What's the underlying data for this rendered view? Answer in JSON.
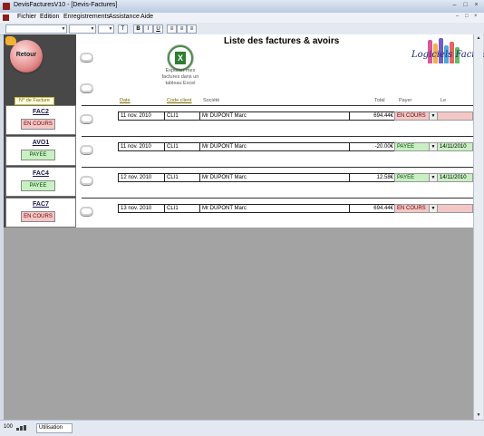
{
  "window": {
    "title": "DevisFacturesV10 - [Devis-Factures]",
    "controls": [
      "–",
      "□",
      "×"
    ]
  },
  "menu": {
    "items": [
      "Fichier",
      "Edition",
      "Enregistrements",
      "Assistance",
      "Aide"
    ],
    "mdi_controls": [
      "–",
      "□",
      "×"
    ]
  },
  "toolbar": {
    "bold": "B",
    "italic": "I",
    "text_tool": "T",
    "underline": "U",
    "align_left": "≡",
    "align_center": "≡",
    "align_right": "≡"
  },
  "sidebar": {
    "back_label": "Retour"
  },
  "header": {
    "title": "Liste des factures & avoirs",
    "export_text": "Exporter mes factures dans un tableau Excel",
    "excel_glyph": "X",
    "logo_text": "Logiciels Faciles"
  },
  "columns": {
    "invoice_no": "N° de Facture",
    "date": "Date",
    "client_code": "Code client",
    "company": "Société",
    "total": "Total",
    "payer": "Payer",
    "le": "Le"
  },
  "invoices": [
    {
      "number": "FAC2",
      "status": "EN COURS",
      "date": "11 nov. 2010",
      "client": "CLI1",
      "company": "Mr DUPONT Marc",
      "total": "694.44€",
      "payer": "EN COURS",
      "paid_on": ""
    },
    {
      "number": "AVO1",
      "status": "PAYEE",
      "date": "11 nov. 2010",
      "client": "CLI1",
      "company": "Mr DUPONT Marc",
      "total": "-20.00€",
      "payer": "PAYEE",
      "paid_on": "14/11/2010"
    },
    {
      "number": "FAC4",
      "status": "PAYEE",
      "date": "12 nov. 2010",
      "client": "CLI1",
      "company": "Mr DUPONT Marc",
      "total": "12.58€",
      "payer": "PAYEE",
      "paid_on": "14/11/2010"
    },
    {
      "number": "FAC7",
      "status": "EN COURS",
      "date": "13 nov. 2010",
      "client": "CLI1",
      "company": "Mr DUPONT Marc",
      "total": "694.44€",
      "payer": "EN COURS",
      "paid_on": ""
    }
  ],
  "statusbar": {
    "zoom": "100",
    "mode": "Utilisation"
  },
  "colors": {
    "unpaid": "#f4c7c7",
    "paid": "#c8f0c2",
    "sidebar": "#484848"
  }
}
